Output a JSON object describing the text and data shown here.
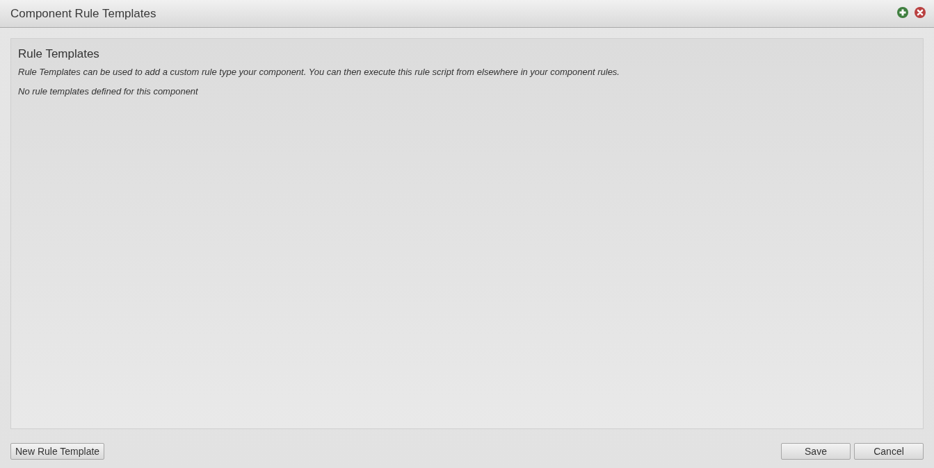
{
  "window": {
    "title": "Component Rule Templates"
  },
  "panel": {
    "heading": "Rule Templates",
    "description": "Rule Templates can be used to add a custom rule type your component. You can then execute this rule script from elsewhere in your component rules.",
    "empty_message": "No rule templates defined for this component"
  },
  "footer": {
    "left_buttons": [
      "New Rule Template"
    ],
    "right_buttons": [
      "Save",
      "Cancel"
    ]
  }
}
